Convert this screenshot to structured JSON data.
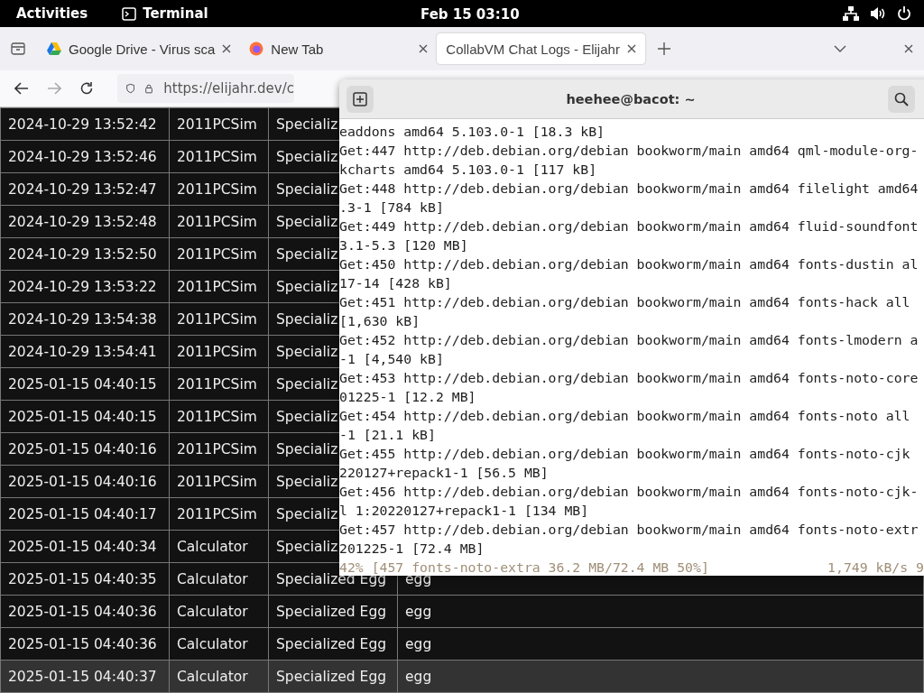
{
  "top_bar": {
    "activities": "Activities",
    "app_name": "Terminal",
    "clock": "Feb 15  03:10"
  },
  "browser": {
    "tabs": [
      {
        "title": "Google Drive - Virus sca",
        "selected": false
      },
      {
        "title": "New Tab",
        "selected": false
      },
      {
        "title": "CollabVM Chat Logs - Elijahr",
        "selected": true
      }
    ],
    "address": "https://elijahr.dev/c",
    "rows": [
      {
        "cells": [
          "2024-10-29 13:52:42",
          "2011PCSim",
          "Specializ"
        ],
        "highlighted": false
      },
      {
        "cells": [
          "2024-10-29 13:52:46",
          "2011PCSim",
          "Specializ"
        ],
        "highlighted": false
      },
      {
        "cells": [
          "2024-10-29 13:52:47",
          "2011PCSim",
          "Specializ"
        ],
        "highlighted": false
      },
      {
        "cells": [
          "2024-10-29 13:52:48",
          "2011PCSim",
          "Specializ"
        ],
        "highlighted": false
      },
      {
        "cells": [
          "2024-10-29 13:52:50",
          "2011PCSim",
          "Specializ"
        ],
        "highlighted": false
      },
      {
        "cells": [
          "2024-10-29 13:53:22",
          "2011PCSim",
          "Specializ"
        ],
        "highlighted": false
      },
      {
        "cells": [
          "2024-10-29 13:54:38",
          "2011PCSim",
          "Specializ"
        ],
        "highlighted": false
      },
      {
        "cells": [
          "2024-10-29 13:54:41",
          "2011PCSim",
          "Specializ"
        ],
        "highlighted": false
      },
      {
        "cells": [
          "2025-01-15 04:40:15",
          "2011PCSim",
          "Specializ"
        ],
        "highlighted": false
      },
      {
        "cells": [
          "2025-01-15 04:40:15",
          "2011PCSim",
          "Specializ"
        ],
        "highlighted": false
      },
      {
        "cells": [
          "2025-01-15 04:40:16",
          "2011PCSim",
          "Specializ"
        ],
        "highlighted": false
      },
      {
        "cells": [
          "2025-01-15 04:40:16",
          "2011PCSim",
          "Specializ"
        ],
        "highlighted": false
      },
      {
        "cells": [
          "2025-01-15 04:40:17",
          "2011PCSim",
          "Specializ"
        ],
        "highlighted": false
      },
      {
        "cells": [
          "2025-01-15 04:40:34",
          "Calculator",
          "Specializ"
        ],
        "highlighted": false
      },
      {
        "cells": [
          "2025-01-15 04:40:35",
          "Calculator",
          "Specialized Egg",
          "egg"
        ],
        "highlighted": false
      },
      {
        "cells": [
          "2025-01-15 04:40:36",
          "Calculator",
          "Specialized Egg",
          "egg"
        ],
        "highlighted": false
      },
      {
        "cells": [
          "2025-01-15 04:40:36",
          "Calculator",
          "Specialized Egg",
          "egg"
        ],
        "highlighted": false
      },
      {
        "cells": [
          "2025-01-15 04:40:37",
          "Calculator",
          "Specialized Egg",
          "egg"
        ],
        "highlighted": true
      }
    ]
  },
  "terminal": {
    "title": "heehee@bacot: ~",
    "lines": [
      "eaddons amd64 5.103.0-1 [18.3 kB]",
      "Get:447 http://deb.debian.org/debian bookworm/main amd64 qml-module-org-",
      "kcharts amd64 5.103.0-1 [117 kB]",
      "Get:448 http://deb.debian.org/debian bookworm/main amd64 filelight amd64",
      ".3-1 [784 kB]",
      "Get:449 http://deb.debian.org/debian bookworm/main amd64 fluid-soundfont",
      "3.1-5.3 [120 MB]",
      "Get:450 http://deb.debian.org/debian bookworm/main amd64 fonts-dustin al",
      "17-14 [428 kB]",
      "Get:451 http://deb.debian.org/debian bookworm/main amd64 fonts-hack all",
      "[1,630 kB]",
      "Get:452 http://deb.debian.org/debian bookworm/main amd64 fonts-lmodern a",
      "-1 [4,540 kB]",
      "Get:453 http://deb.debian.org/debian bookworm/main amd64 fonts-noto-core",
      "01225-1 [12.2 MB]",
      "Get:454 http://deb.debian.org/debian bookworm/main amd64 fonts-noto all",
      "-1 [21.1 kB]",
      "Get:455 http://deb.debian.org/debian bookworm/main amd64 fonts-noto-cjk",
      "220127+repack1-1 [56.5 MB]",
      "Get:456 http://deb.debian.org/debian bookworm/main amd64 fonts-noto-cjk-",
      "l 1:20220127+repack1-1 [134 MB]",
      "Get:457 http://deb.debian.org/debian bookworm/main amd64 fonts-noto-extr",
      "201225-1 [72.4 MB]"
    ],
    "progress": "42% [457 fonts-noto-extra 36.2 MB/72.4 MB 50%]",
    "rate": "1,749 kB/s 9"
  }
}
